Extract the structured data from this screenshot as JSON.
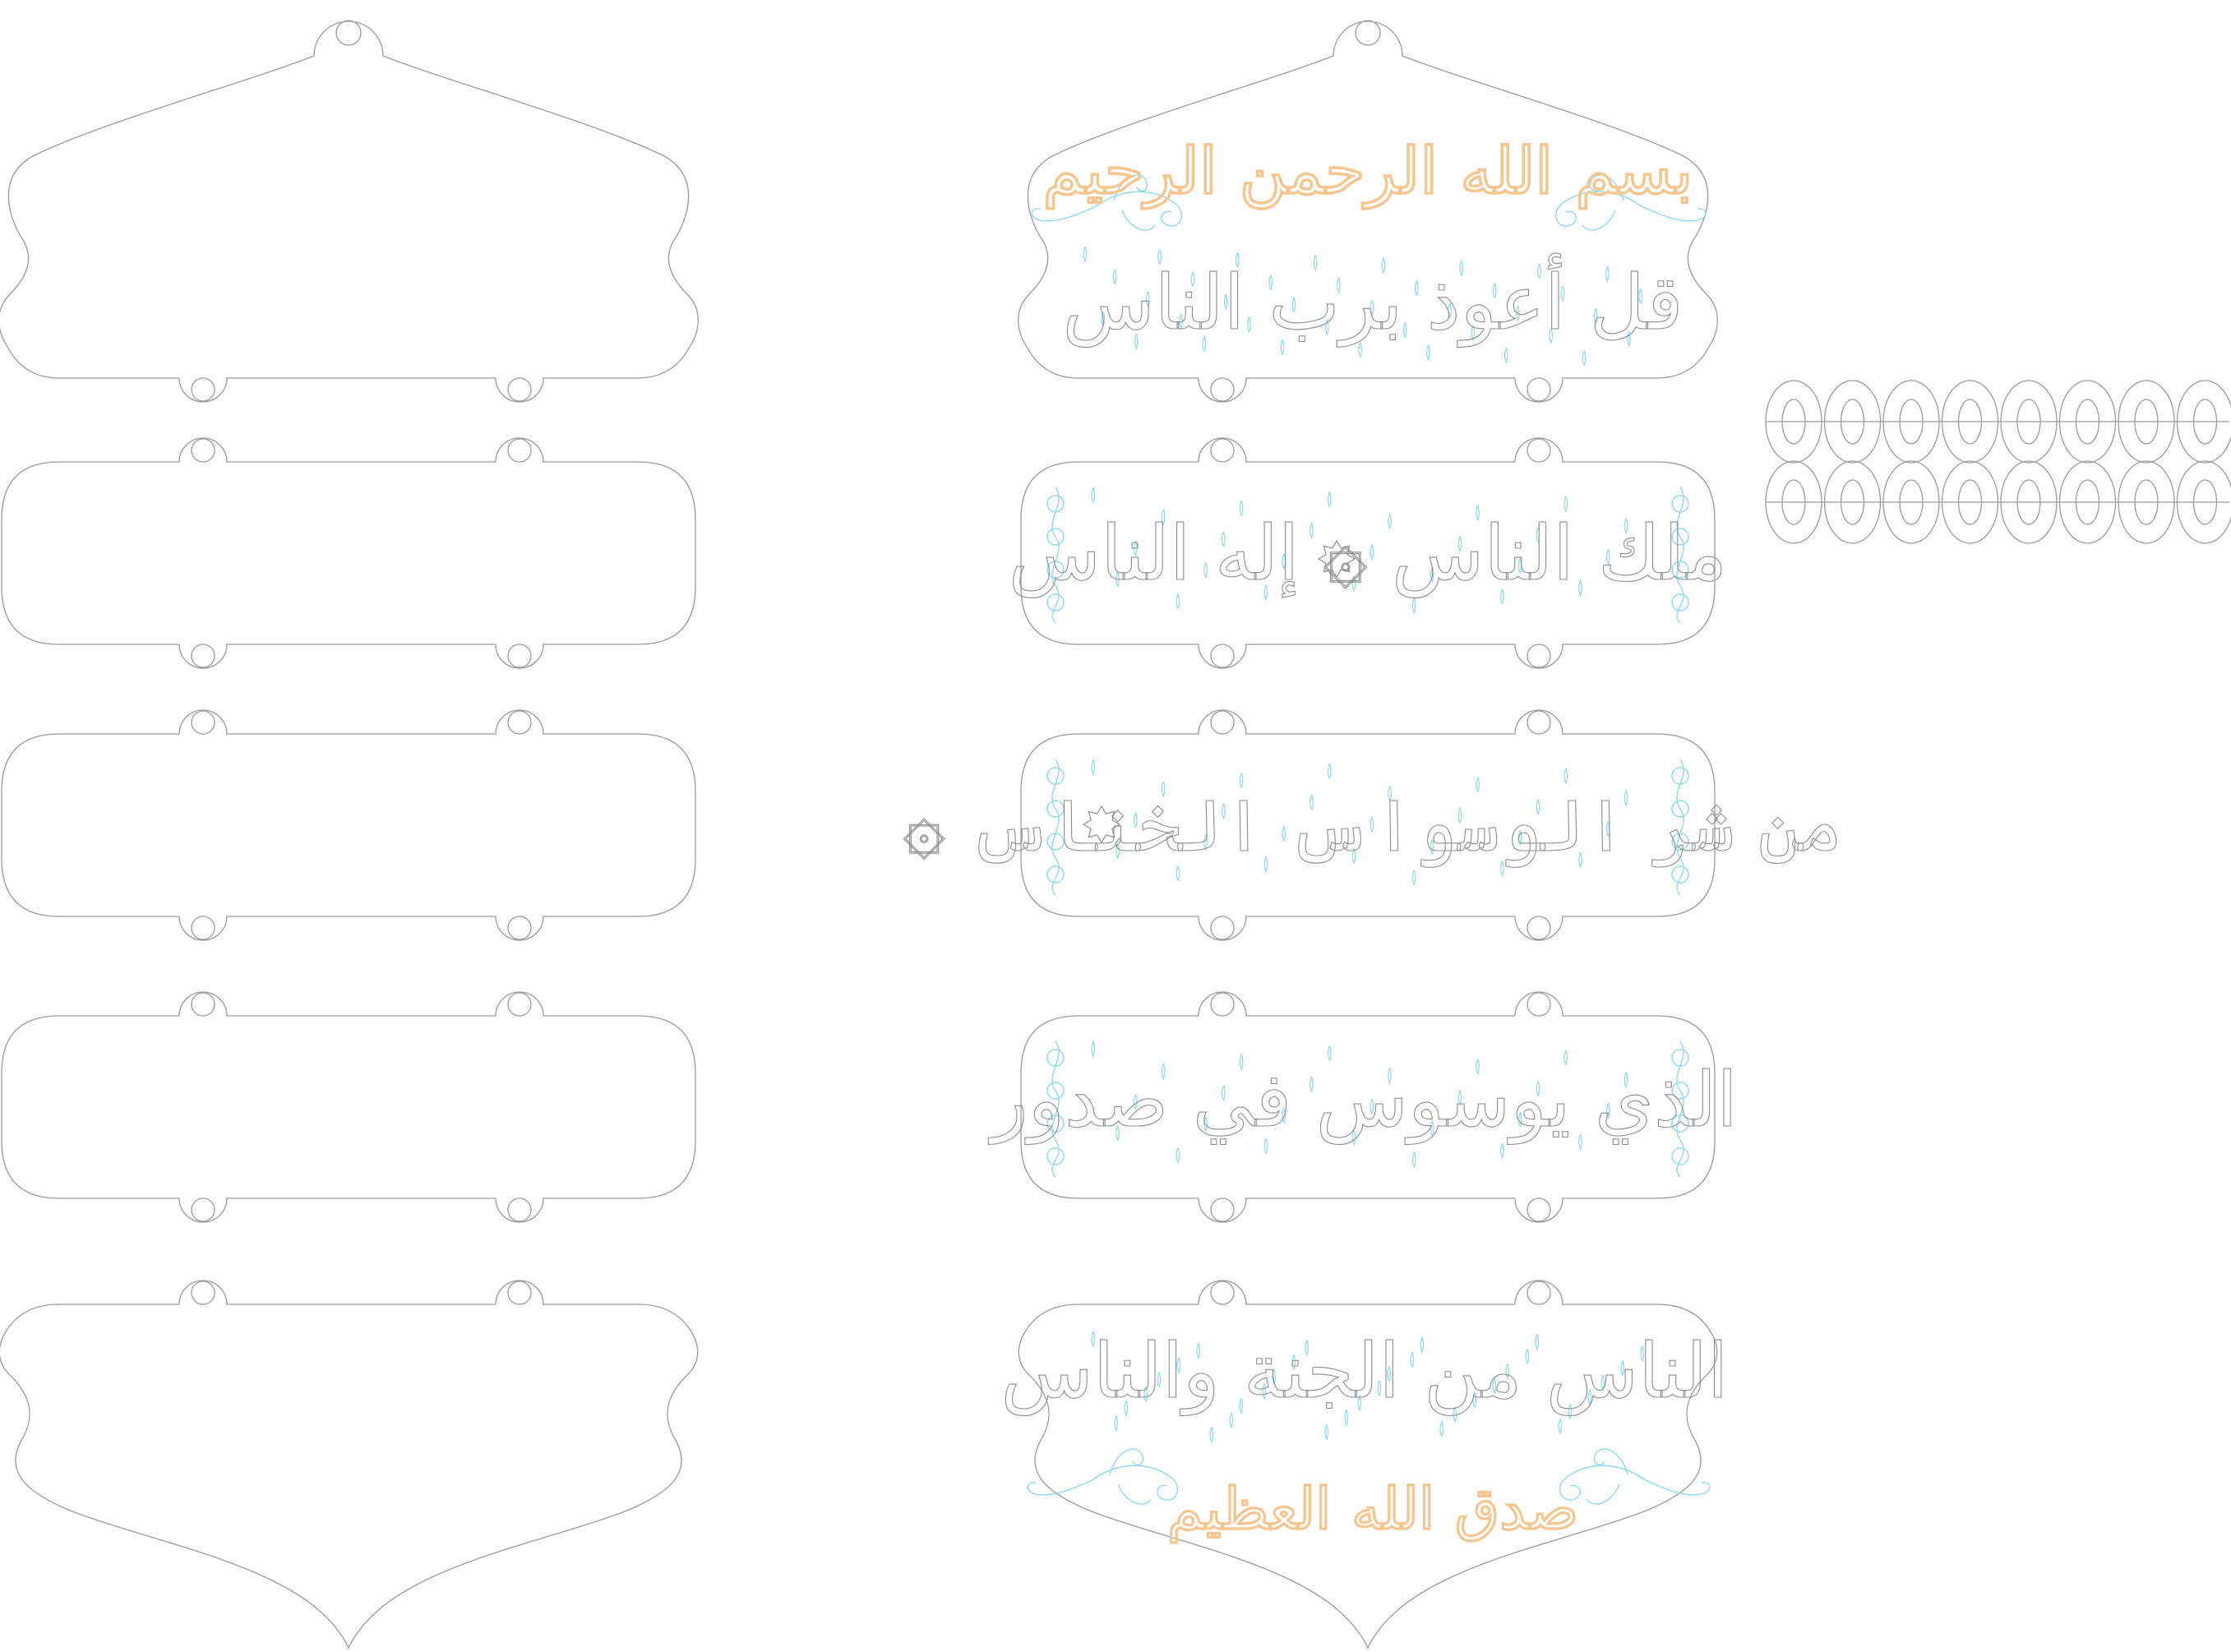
{
  "colors": {
    "background": "#ffffff",
    "outline": "#9a9a9a",
    "calligraphy": "#8c8c8c",
    "ornament": "#8fd8f0",
    "accent": "#f6c690"
  },
  "blank_set": {
    "panel_count": 5
  },
  "engraved_set": {
    "header": "بسم الله الرحمن الرحيم",
    "verses": [
      "قل أعوذ برب الناس",
      "ملك الناس ۞ إله الناس",
      "من شر الوسواس الخناس ۞",
      "الذي يوسوس في صدور",
      "الناس من الجنة والناس"
    ],
    "footer": "صدق الله العظيم"
  },
  "spacer_rings": {
    "rows": 2,
    "per_row": 8
  }
}
